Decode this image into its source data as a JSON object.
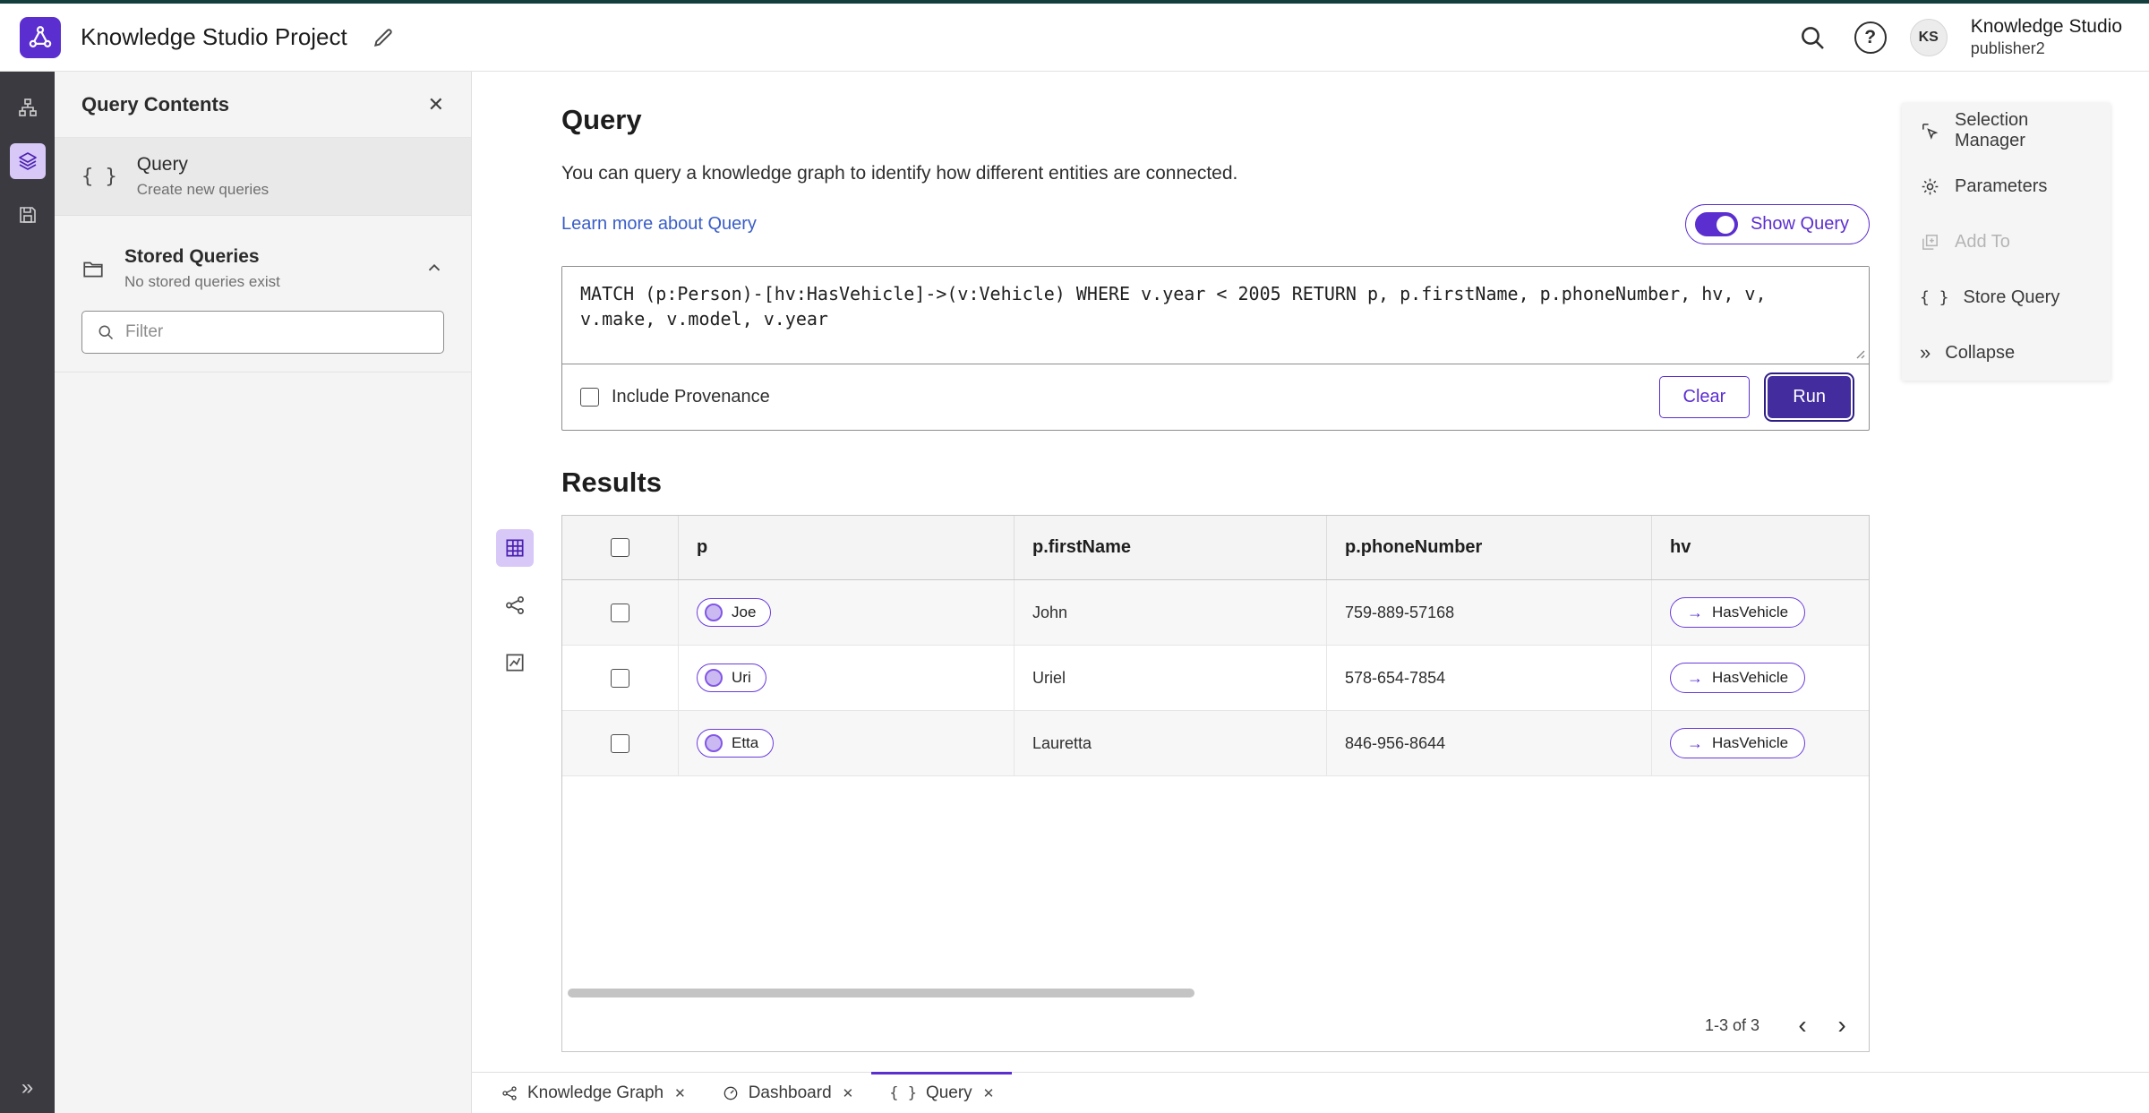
{
  "header": {
    "title": "Knowledge Studio Project",
    "account": {
      "initials": "KS",
      "app_name": "Knowledge Studio",
      "user_name": "publisher2"
    }
  },
  "left_panel": {
    "title": "Query Contents",
    "close_glyph": "✕",
    "query_item": {
      "icon_glyph": "{ }",
      "label": "Query",
      "sublabel": "Create new queries"
    },
    "stored_queries": {
      "label": "Stored Queries",
      "sublabel": "No stored queries exist"
    },
    "filter": {
      "placeholder": "Filter"
    }
  },
  "query_panel": {
    "title": "Query",
    "description": "You can query a knowledge graph to identify how different entities are connected.",
    "learn_more_link": "Learn more about Query",
    "show_query_label": "Show Query",
    "query_text": "MATCH (p:Person)-[hv:HasVehicle]->(v:Vehicle) WHERE v.year < 2005 RETURN p, p.firstName, p.phoneNumber, hv, v, v.make, v.model, v.year",
    "include_provenance_label": "Include Provenance",
    "clear_button": "Clear",
    "run_button": "Run"
  },
  "results": {
    "title": "Results",
    "columns": [
      "p",
      "p.firstName",
      "p.phoneNumber",
      "hv"
    ],
    "rows": [
      {
        "p": "Joe",
        "firstName": "John",
        "phoneNumber": "759-889-57168",
        "hv": "HasVehicle"
      },
      {
        "p": "Uri",
        "firstName": "Uriel",
        "phoneNumber": "578-654-7854",
        "hv": "HasVehicle"
      },
      {
        "p": "Etta",
        "firstName": "Lauretta",
        "phoneNumber": "846-956-8644",
        "hv": "HasVehicle"
      }
    ],
    "edge_arrow_glyph": "→",
    "pagination": {
      "range_label": "1-3 of 3",
      "prev_glyph": "‹",
      "next_glyph": "›"
    }
  },
  "right_menu": {
    "items": [
      {
        "label": "Selection Manager"
      },
      {
        "label": "Parameters"
      },
      {
        "label": "Add To"
      },
      {
        "label": "Store Query"
      },
      {
        "label": "Collapse"
      }
    ]
  },
  "bottom_tabs": [
    {
      "label": "Knowledge Graph"
    },
    {
      "label": "Dashboard"
    },
    {
      "label": "Query"
    }
  ],
  "colors": {
    "accent_purple": "#5b2ed0",
    "run_button": "#432c9e",
    "node_fill": "#cbb9f1",
    "rail_background": "#3a3a40",
    "panel_background": "#f4f4f4",
    "link_blue": "#3a5dc8",
    "selected_icon_bg": "#d8c8f8"
  }
}
